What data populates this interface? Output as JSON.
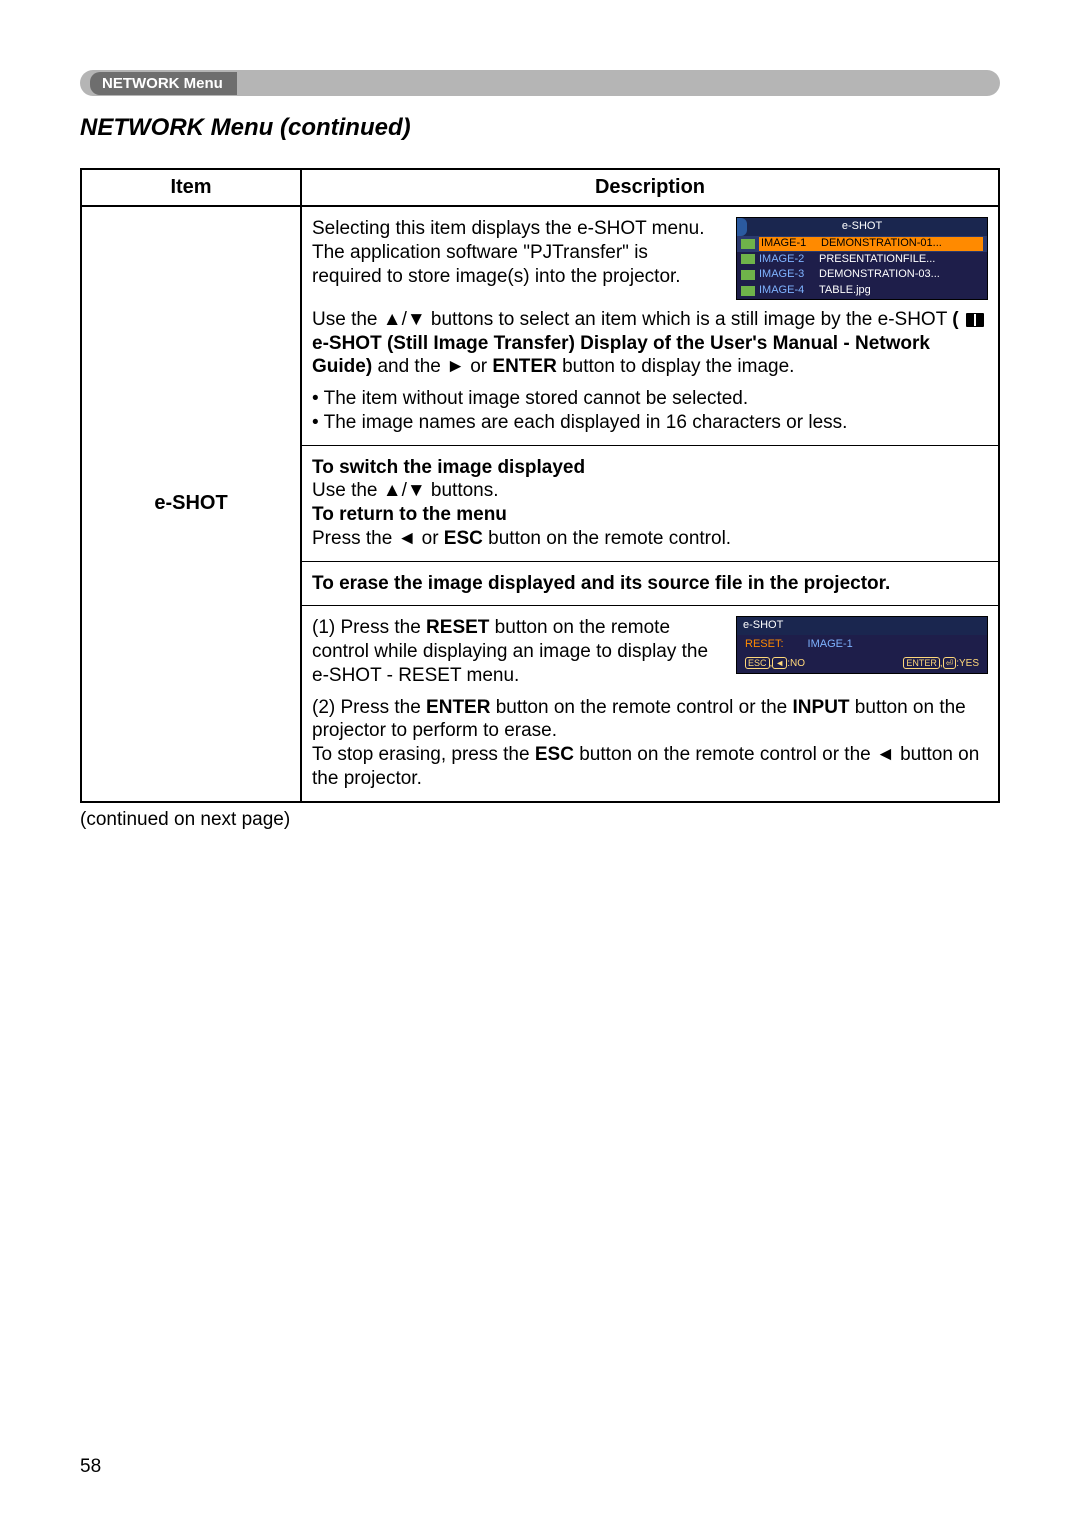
{
  "breadcrumb": "NETWORK Menu",
  "section_title": "NETWORK Menu (continued)",
  "table": {
    "headers": {
      "item": "Item",
      "description": "Description"
    },
    "row": {
      "item": "e-SHOT",
      "p1a": "Selecting this item displays the e-SHOT menu.",
      "p1b": "The application software \"PJTransfer\" is required to store image(s) into the projector.",
      "p1c_pre": "Use the ▲/▼ buttons to select an item which is a still image by the e-SHOT ",
      "p1c_bold1": "( ",
      "p1c_bold2": " e-SHOT (Still Image Transfer) Display of the User's Manual - Network Guide)",
      "p1c_post": " and the ► or ",
      "p1c_enter": "ENTER",
      "p1c_tail": " button to display the image.",
      "bullet1": "• The item without image stored cannot be selected.",
      "bullet2": "• The image names are each displayed in 16 characters or less.",
      "switch_h": "To switch the image displayed",
      "switch_t": "Use the ▲/▼ buttons.",
      "return_h": "To return to the menu",
      "return_t_pre": "Press the ◄ or ",
      "return_t_esc": "ESC",
      "return_t_post": " button on the remote control.",
      "erase_h": "To erase the image displayed and its source file in the projector.",
      "step1_pre": "(1) Press the ",
      "step1_reset": "RESET",
      "step1_post": " button on the remote control while displaying an image to display the e-SHOT - RESET menu.",
      "step2_pre": "(2) Press the ",
      "step2_enter": "ENTER",
      "step2_mid": " button on the remote control or the ",
      "step2_input": "INPUT",
      "step2_post1": " button on the projector to perform to erase.",
      "step2_post2_pre": "To stop erasing, press the ",
      "step2_esc": "ESC",
      "step2_post2_post": " button on the remote control or the ◄ button on the projector."
    }
  },
  "eshot_menu": {
    "title": "e-SHOT",
    "rows": [
      {
        "label": "IMAGE-1",
        "file": "DEMONSTRATION-01...",
        "sel": true
      },
      {
        "label": "IMAGE-2",
        "file": "PRESENTATIONFILE...",
        "sel": false
      },
      {
        "label": "IMAGE-3",
        "file": "DEMONSTRATION-03...",
        "sel": false
      },
      {
        "label": "IMAGE-4",
        "file": "TABLE.jpg",
        "sel": false
      }
    ]
  },
  "eshot_reset": {
    "title": "e-SHOT",
    "label": "RESET:",
    "value": "IMAGE-1",
    "no_key": "ESC",
    "no_sym": "◄",
    "no_txt": ":NO",
    "yes_key": "ENTER",
    "yes_sym": "⏎",
    "yes_txt": ":YES"
  },
  "continued": "(continued on next page)",
  "page_num": "58"
}
